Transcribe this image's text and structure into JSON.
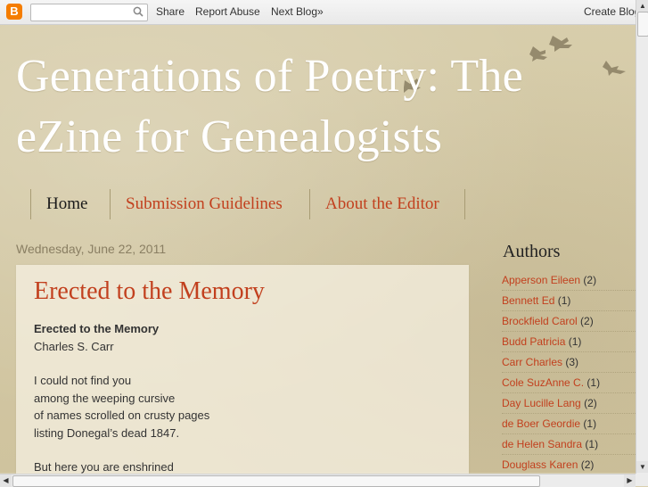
{
  "navbar": {
    "logo_letter": "B",
    "search_placeholder": "",
    "share": "Share",
    "report_abuse": "Report Abuse",
    "next_blog": "Next Blog»",
    "create_blog": "Create Blog"
  },
  "blog": {
    "title": "Generations of Poetry: The eZine for Genealogists"
  },
  "tabs": [
    {
      "label": "Home"
    },
    {
      "label": "Submission Guidelines"
    },
    {
      "label": "About the Editor"
    }
  ],
  "post": {
    "date": "Wednesday, June 22, 2011",
    "title": "Erected to the Memory",
    "lines": [
      "Erected to the Memory",
      "Charles S. Carr",
      "",
      "I could not find you",
      "among the weeping cursive",
      "of names scrolled on crusty pages",
      "listing Donegal’s dead 1847.",
      "",
      "But here you are enshrined"
    ]
  },
  "sidebar": {
    "title": "Authors",
    "items": [
      {
        "name": "Apperson Eileen",
        "count": "(2)"
      },
      {
        "name": "Bennett Ed",
        "count": "(1)"
      },
      {
        "name": "Brockfield Carol",
        "count": "(2)"
      },
      {
        "name": "Budd Patricia",
        "count": "(1)"
      },
      {
        "name": "Carr Charles",
        "count": "(3)"
      },
      {
        "name": "Cole SuzAnne C.",
        "count": "(1)"
      },
      {
        "name": "Day Lucille Lang",
        "count": "(2)"
      },
      {
        "name": "de Boer Geordie",
        "count": "(1)"
      },
      {
        "name": "de Helen Sandra",
        "count": "(1)"
      },
      {
        "name": "Douglass Karen",
        "count": "(2)"
      }
    ]
  },
  "colors": {
    "link": "#c2401e",
    "background": "#d9cfae",
    "title_text": "#ffffff"
  }
}
